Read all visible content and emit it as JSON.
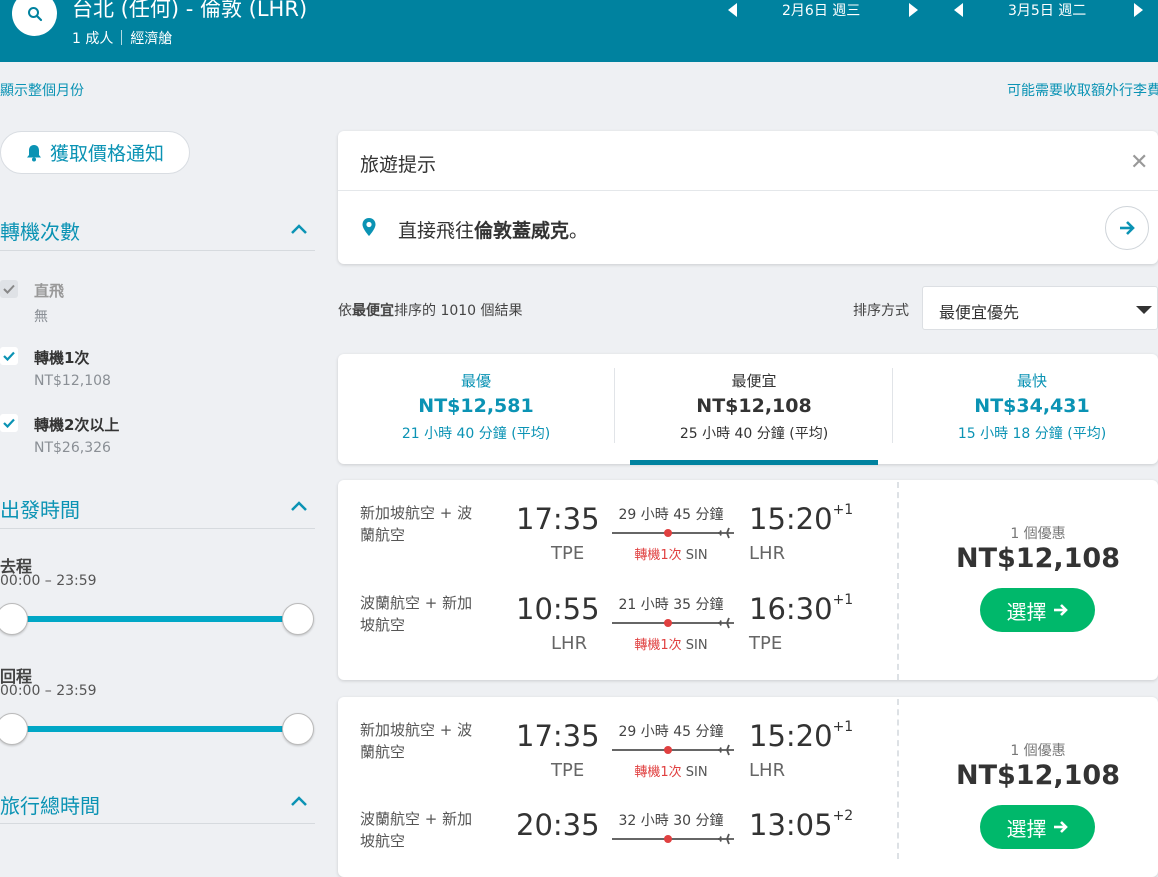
{
  "header": {
    "route": "台北 (任何) - 倫敦 (LHR)",
    "passengers": "1 成人",
    "cabin": "經濟艙",
    "depart_date": "2月6日 週三",
    "return_date": "3月5日 週二"
  },
  "subbar": {
    "left_link": "顯示整個月份",
    "right_link": "可能需要收取額外行李費"
  },
  "sidebar": {
    "price_alert": "獲取價格通知",
    "stops_title": "轉機次數",
    "stops": [
      {
        "label": "直飛",
        "sub": "無",
        "checked": true,
        "disabled": true
      },
      {
        "label": "轉機1次",
        "sub": "NT$12,108",
        "checked": true,
        "disabled": false
      },
      {
        "label": "轉機2次以上",
        "sub": "NT$26,326",
        "checked": true,
        "disabled": false
      }
    ],
    "departure_title": "出發時間",
    "outbound_label": "去程",
    "outbound_range": "00:00 – 23:59",
    "return_label": "回程",
    "return_range": "00:00 – 23:59",
    "duration_title": "旅行總時間"
  },
  "tips": {
    "title": "旅遊提示",
    "text_prefix": "直接飛往",
    "text_bold": "倫敦蓋威克",
    "text_suffix": "。"
  },
  "results": {
    "count_prefix": "依",
    "count_bold": "最便宜",
    "count_suffix": "排序的 1010 個結果",
    "sort_label": "排序方式",
    "sort_value": "最便宜優先"
  },
  "tabs": [
    {
      "label": "最優",
      "price": "NT$12,581",
      "duration": "21 小時 40 分鐘 (平均)"
    },
    {
      "label": "最便宜",
      "price": "NT$12,108",
      "duration": "25 小時 40 分鐘 (平均)"
    },
    {
      "label": "最快",
      "price": "NT$34,431",
      "duration": "15 小時 18 分鐘 (平均)"
    }
  ],
  "flights": [
    {
      "legs": [
        {
          "airline": "新加坡航空 + 波蘭航空",
          "dep_time": "17:35",
          "dep_apt": "TPE",
          "duration": "29 小時 45 分鐘",
          "stops": "轉機1次",
          "via": "SIN",
          "arr_time": "15:20",
          "arr_plus": "+1",
          "arr_apt": "LHR"
        },
        {
          "airline": "波蘭航空 + 新加坡航空",
          "dep_time": "10:55",
          "dep_apt": "LHR",
          "duration": "21 小時 35 分鐘",
          "stops": "轉機1次",
          "via": "SIN",
          "arr_time": "16:30",
          "arr_plus": "+1",
          "arr_apt": "TPE"
        }
      ],
      "deals": "1 個優惠",
      "price": "NT$12,108",
      "select": "選擇"
    },
    {
      "legs": [
        {
          "airline": "新加坡航空 + 波蘭航空",
          "dep_time": "17:35",
          "dep_apt": "TPE",
          "duration": "29 小時 45 分鐘",
          "stops": "轉機1次",
          "via": "SIN",
          "arr_time": "15:20",
          "arr_plus": "+1",
          "arr_apt": "LHR"
        },
        {
          "airline": "波蘭航空 + 新加坡航空",
          "dep_time": "20:35",
          "dep_apt": "",
          "duration": "32 小時 30 分鐘",
          "stops": "",
          "via": "",
          "arr_time": "13:05",
          "arr_plus": "+2",
          "arr_apt": ""
        }
      ],
      "deals": "1 個優惠",
      "price": "NT$12,108",
      "select": "選擇"
    }
  ],
  "colors": {
    "header": "#00829f",
    "accent": "#0b93b4",
    "select_btn": "#00b86b",
    "stop_red": "#e04040"
  }
}
